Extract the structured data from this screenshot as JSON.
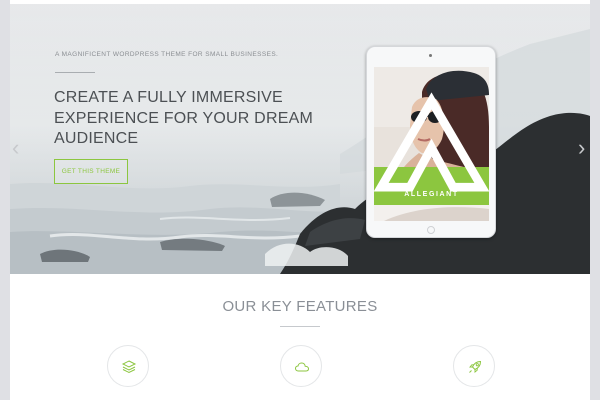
{
  "hero": {
    "tagline": "A MAGNIFICENT WORDPRESS THEME FOR SMALL BUSINESSES.",
    "headline": "CREATE A FULLY IMMERSIVE EXPERIENCE FOR YOUR DREAM AUDIENCE",
    "cta_label": "GET THIS THEME",
    "prev_arrow": "‹",
    "next_arrow": "›",
    "device": {
      "brand_name": "ALLEGIANT",
      "accent_color": "#8cc63f"
    }
  },
  "features": {
    "title": "OUR KEY FEATURES",
    "items": [
      {
        "icon": "layers-icon"
      },
      {
        "icon": "cloud-icon"
      },
      {
        "icon": "rocket-icon"
      }
    ]
  },
  "colors": {
    "accent": "#8cc63f",
    "headline_text": "#4c5054",
    "muted_text": "#8a8f96"
  }
}
